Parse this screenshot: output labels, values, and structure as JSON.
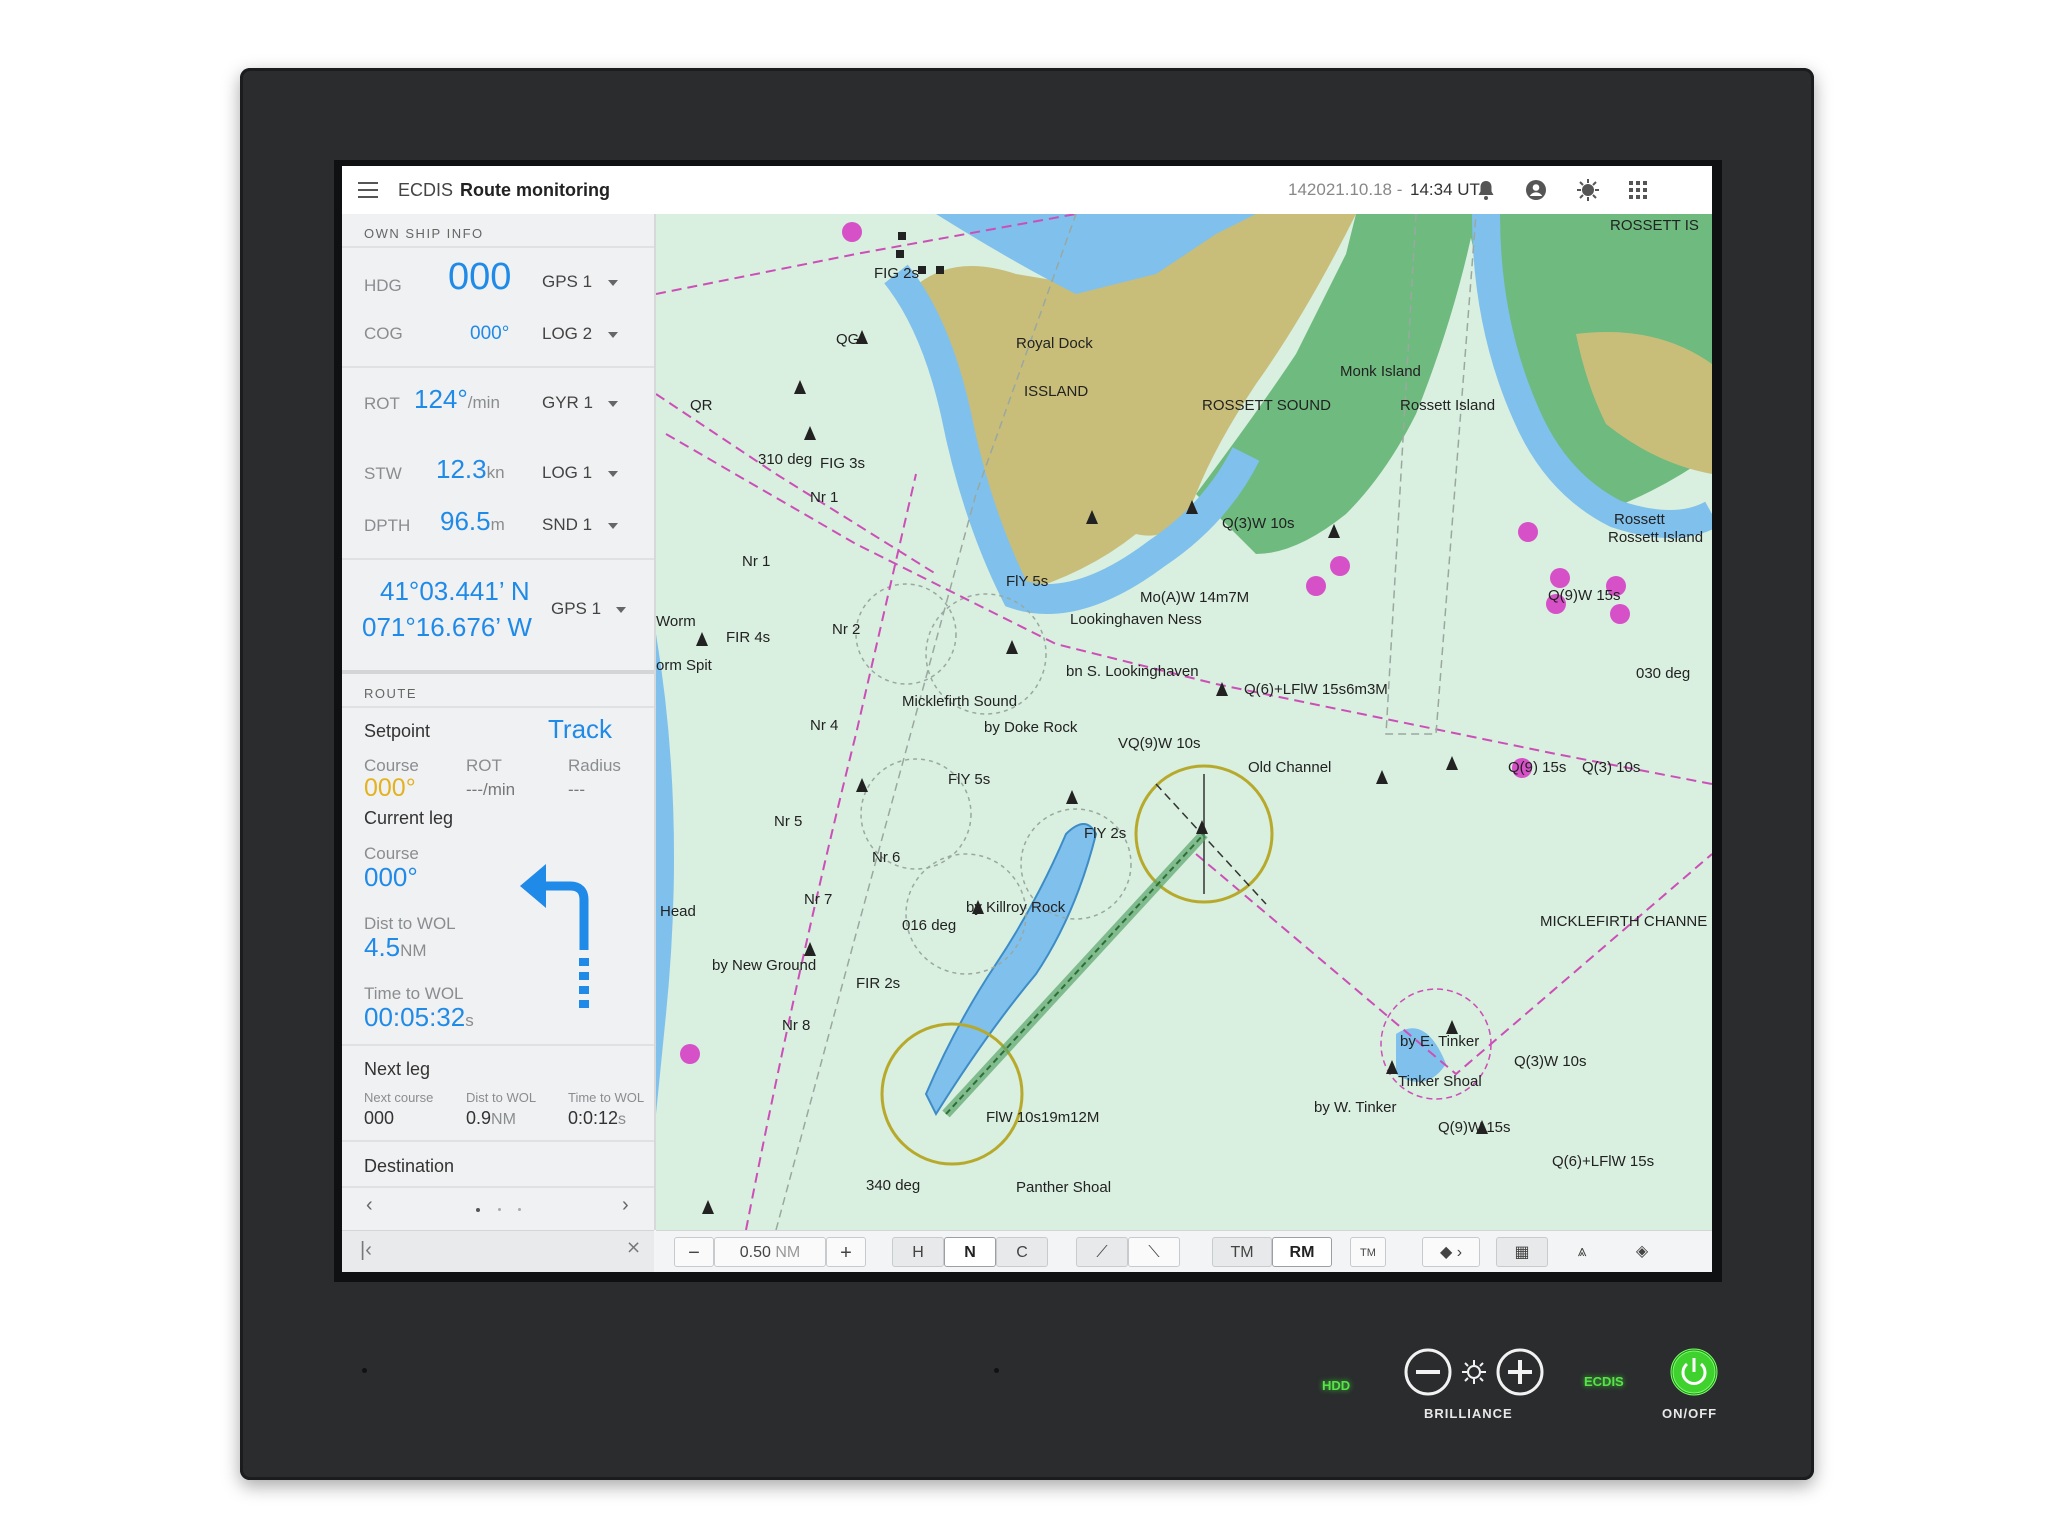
{
  "topbar": {
    "app_name": "ECDIS",
    "mode": "Route monitoring",
    "date": "142021.10.18 -",
    "time": "14:34 UTC"
  },
  "own_ship": {
    "header": "OWN SHIP INFO",
    "hdg": {
      "label": "HDG",
      "value": "000",
      "source": "GPS 1"
    },
    "cog": {
      "label": "COG",
      "value": "000°",
      "source": "LOG 2"
    },
    "rot": {
      "label": "ROT",
      "value": "124°",
      "unit": "/min",
      "source": "GYR 1"
    },
    "stw": {
      "label": "STW",
      "value": "12.3",
      "unit": "kn",
      "source": "LOG 1"
    },
    "dpth": {
      "label": "DPTH",
      "value": "96.5",
      "unit": "m",
      "source": "SND 1"
    },
    "position": {
      "lat": "41°03.441’ N",
      "lon": "071°16.676’ W",
      "source": "GPS 1"
    }
  },
  "route": {
    "header": "ROUTE",
    "setpoint_label": "Setpoint",
    "setpoint_mode": "Track",
    "course_label": "Course",
    "rot_label": "ROT",
    "radius_label": "Radius",
    "course_value": "000°",
    "rot_value": "---",
    "rot_unit": "/min",
    "radius_value": "---",
    "current_leg": {
      "title": "Current leg",
      "course_label": "Course",
      "course_value": "000°",
      "dist_label": "Dist to WOL",
      "dist_value": "4.5",
      "dist_unit": "NM",
      "time_label": "Time to WOL",
      "time_value": "00:05:32",
      "time_unit": "s"
    },
    "next_leg": {
      "title": "Next leg",
      "course_label": "Next course",
      "course_value": "000",
      "dist_label": "Dist to WOL",
      "dist_value": "0.9",
      "dist_unit": "NM",
      "time_label": "Time to WOL",
      "time_value": "0:0:12",
      "time_unit": "s"
    },
    "destination_label": "Destination"
  },
  "toolbar": {
    "range_value": "0.50",
    "range_unit": "NM",
    "orient": [
      "H",
      "N",
      "C"
    ],
    "tm": "TM",
    "rm": "RM",
    "tm_small": "TM"
  },
  "map_labels": {
    "royal_dock": "Royal Dock",
    "island": "ISSLAND",
    "monk_island": "Monk Island",
    "rossett_sound": "ROSSETT SOUND",
    "rossett_island": "Rossett Island",
    "rossett_is_top": "ROSSETT IS",
    "rossett": "Rossett",
    "rossett_island2": "Rossett Island",
    "fig2s": "FIG 2s",
    "qg": "QG",
    "qr": "QR",
    "deg310": "310 deg",
    "fig3s": "FIG 3s",
    "nr1a": "Nr 1",
    "nr1b": "Nr 1",
    "fly5s_a": "FlY 5s",
    "q3w10s_a": "Q(3)W 10s",
    "q9w15s_a": "Q(9)W 15s",
    "moaw": "Mo(A)W 14m7M",
    "lookinghaven_ness": "Lookinghaven Ness",
    "worm": "Worm",
    "worm_spit": "orm Spit",
    "fir4s": "FIR 4s",
    "nr2": "Nr 2",
    "bn_look": "bn S. Lookinghaven",
    "q6lflw": "Q(6)+LFlW 15s6m3M",
    "deg030": "030 deg",
    "mickle_sound": "Micklefirth Sound",
    "doke_rock": "by Doke Rock",
    "vq9w": "VQ(9)W 10s",
    "nr4": "Nr 4",
    "old_channel": "Old Channel",
    "q9_15s": "Q(9) 15s",
    "q3_10s": "Q(3) 10s",
    "fly5s_b": "FlY 5s",
    "nr5": "Nr 5",
    "fly2s": "FlY 2s",
    "nr6": "Nr 6",
    "nr7": "Nr 7",
    "head": "Head",
    "deg016": "016 deg",
    "killroy": "by Killroy Rock",
    "mickle_channel": "MICKLEFIRTH CHANNE",
    "new_ground": "by New Ground",
    "fir2s": "FIR 2s",
    "nr8": "Nr 8",
    "e_tinker": "by E. Tinker",
    "q3w10s_b": "Q(3)W 10s",
    "tinker_shoal": "Tinker Shoal",
    "w_tinker": "by W. Tinker",
    "q9w15s_b": "Q(9)W 15s",
    "flw10s": "FlW 10s19m12M",
    "deg340": "340 deg",
    "panther": "Panther Shoal",
    "q6lflw_b": "Q(6)+LFlW 15s"
  },
  "hardware": {
    "hdd": "HDD",
    "brilliance": "BRILLIANCE",
    "ecdis": "ECDIS",
    "onoff": "ON/OFF"
  },
  "colors": {
    "accent": "#1f8ae8",
    "setpoint_course": "#e3b220",
    "land": "#c8be7a",
    "shallow": "#7fc0ec",
    "deep": "#d9efdf",
    "route_line": "#cc4fb8",
    "led_green": "#58e34a"
  }
}
